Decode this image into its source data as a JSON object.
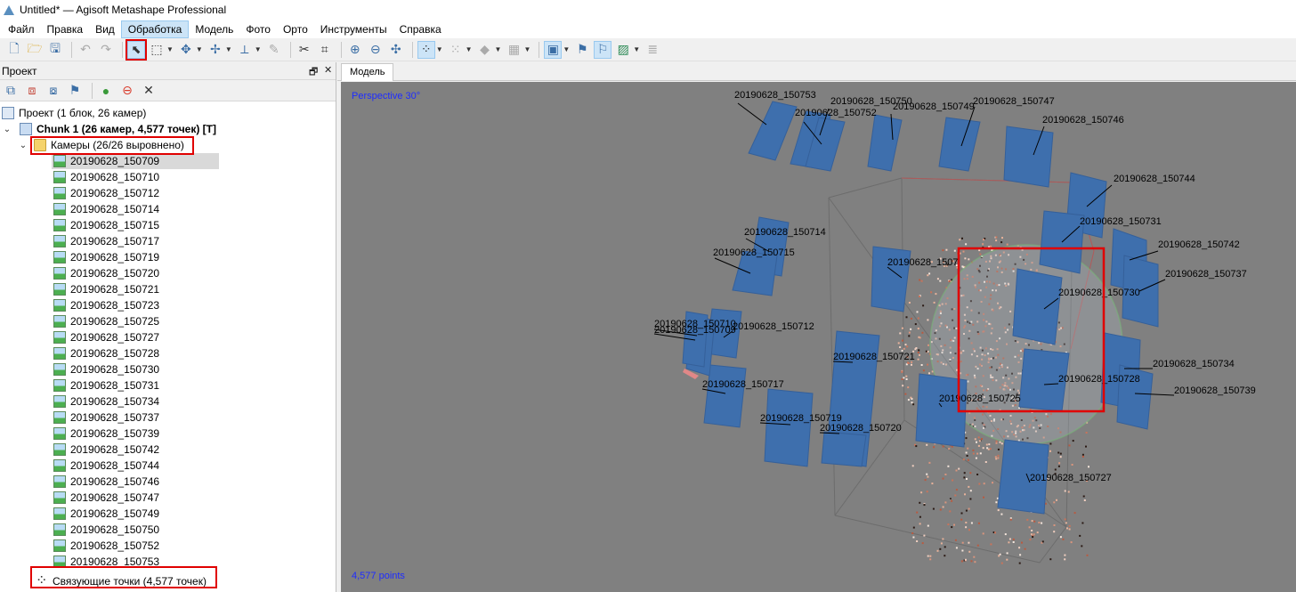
{
  "window": {
    "title": "Untitled* — Agisoft Metashape Professional"
  },
  "menu": [
    {
      "label": "Файл"
    },
    {
      "label": "Правка"
    },
    {
      "label": "Вид"
    },
    {
      "label": "Обработка",
      "active": true
    },
    {
      "label": "Модель"
    },
    {
      "label": "Фото"
    },
    {
      "label": "Орто"
    },
    {
      "label": "Инструменты"
    },
    {
      "label": "Справка"
    }
  ],
  "toolbar": {
    "icons": [
      "new-icon",
      "open-icon",
      "save-icon",
      "undo-icon",
      "redo-icon",
      "navigation-icon",
      "rectangle-selection-icon",
      "move-region-icon",
      "move-object-icon",
      "ruler-icon",
      "cut-icon",
      "crop-icon",
      "zoom-in-icon",
      "zoom-out-icon",
      "reset-view-icon",
      "show-points-icon",
      "show-dense-icon",
      "show-model-icon",
      "show-tiles-icon",
      "show-cameras-icon",
      "show-markers-icon",
      "show-shapes-icon",
      "show-image-icon",
      "show-region-icon"
    ]
  },
  "panel": {
    "title": "Проект",
    "project_label": "Проект (1 блок, 26 камер)",
    "chunk_label": "Chunk 1 (26 камер, 4,577 точек) [T]",
    "cameras_folder_label": "Камеры (26/26 выровнено)",
    "cameras": [
      "20190628_150709",
      "20190628_150710",
      "20190628_150712",
      "20190628_150714",
      "20190628_150715",
      "20190628_150717",
      "20190628_150719",
      "20190628_150720",
      "20190628_150721",
      "20190628_150723",
      "20190628_150725",
      "20190628_150727",
      "20190628_150728",
      "20190628_150730",
      "20190628_150731",
      "20190628_150734",
      "20190628_150737",
      "20190628_150739",
      "20190628_150742",
      "20190628_150744",
      "20190628_150746",
      "20190628_150747",
      "20190628_150749",
      "20190628_150750",
      "20190628_150752",
      "20190628_150753"
    ],
    "selected_camera": "20190628_150709",
    "tie_points_label": "Связующие точки (4,577 точек)"
  },
  "viewport": {
    "tab_label": "Модель",
    "view_label": "Perspective 30°",
    "points_label": "4,577 points",
    "camera_labels": [
      "20190628_150753",
      "20190628_150750",
      "20190628_150752",
      "20190628_150749",
      "20190628_150747",
      "20190628_150746",
      "20190628_150744",
      "20190628_150731",
      "20190628_150742",
      "20190628_150737",
      "20190628_150730",
      "20190628_150714",
      "20190628_150715",
      "20190628_1507",
      "20190628_150712",
      "20190628_150721",
      "20190628_150734",
      "20190628_150728",
      "20190628_150739",
      "20190628_150717",
      "20190628_150725",
      "20190628_150719",
      "20190628_150720",
      "20190628_150727",
      "20190628_150710",
      "20190628_150709"
    ]
  },
  "colors": {
    "viewport_bg": "#808080",
    "camera_plane": "#3e6fad",
    "highlight": "#e00000",
    "overlay_text": "#1e2cff"
  }
}
